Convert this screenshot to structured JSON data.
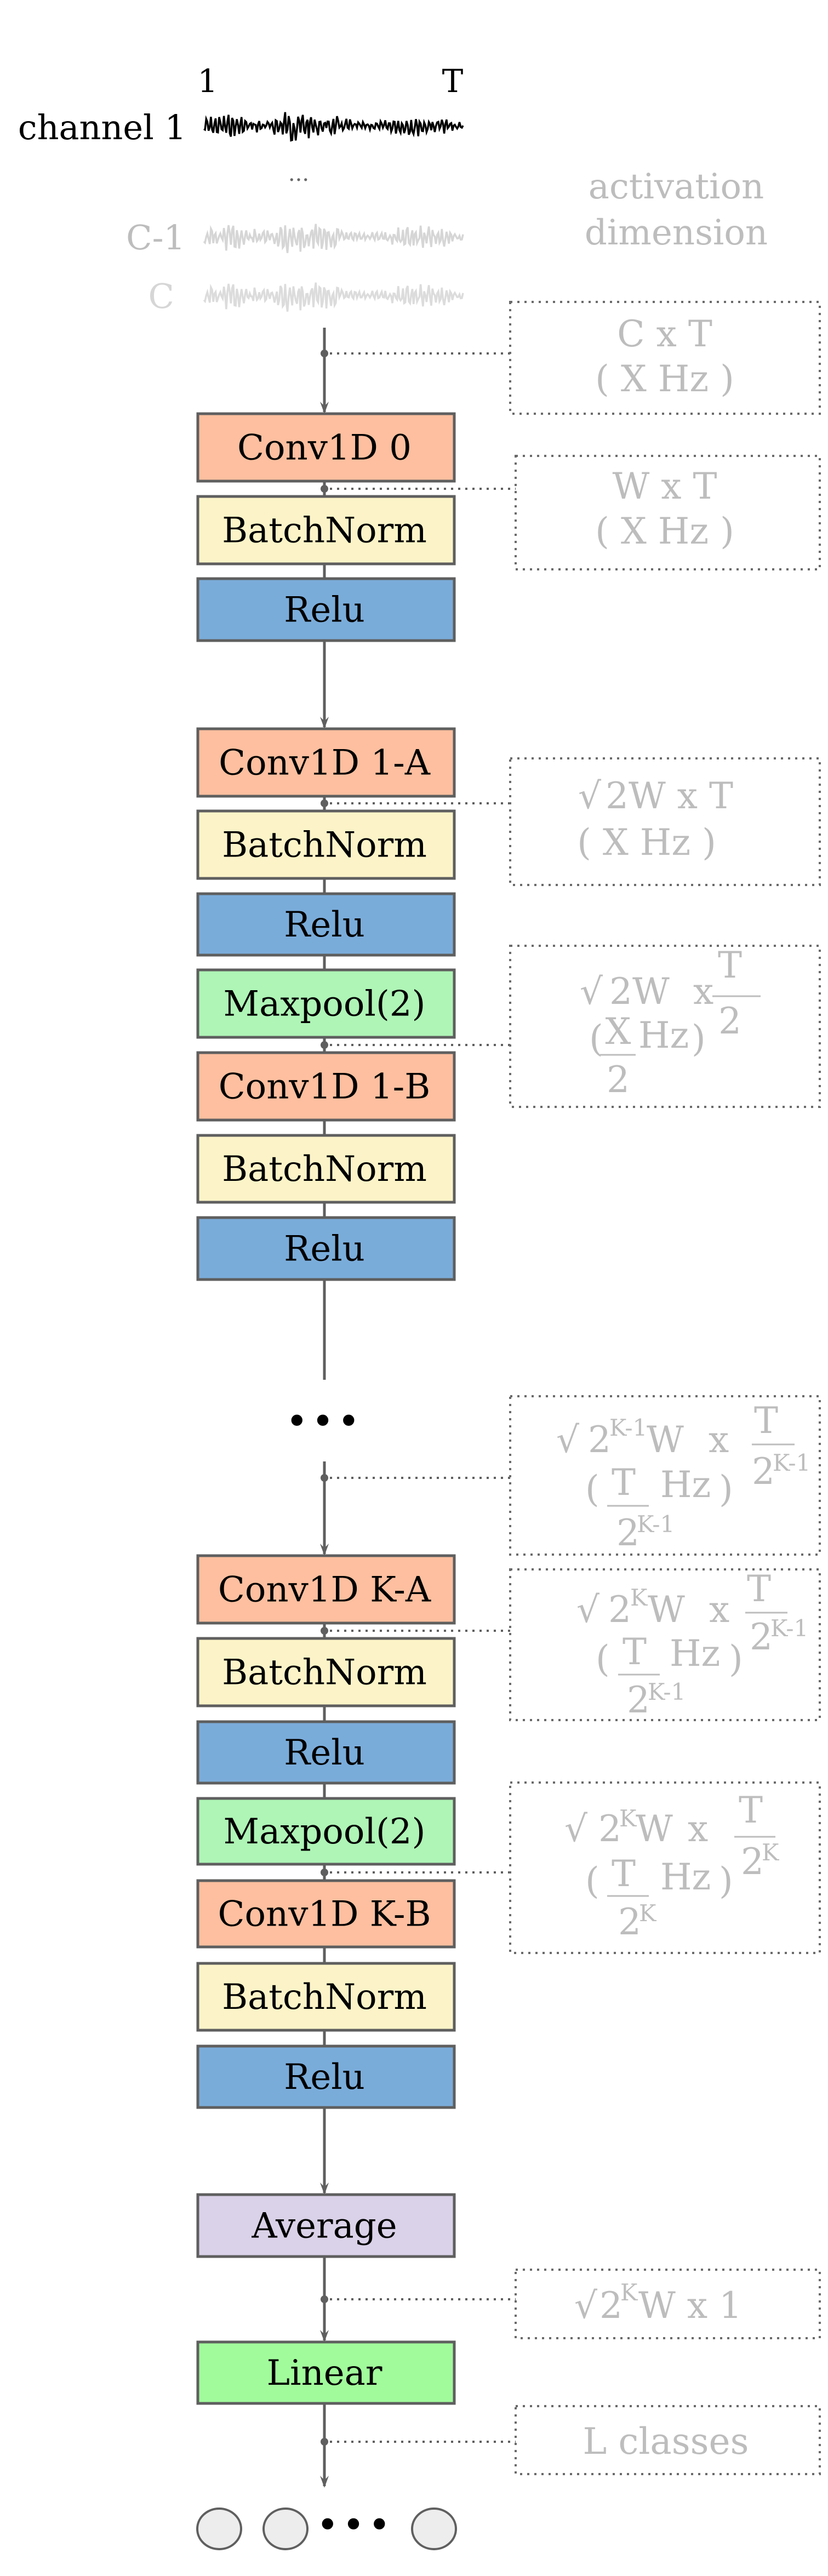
{
  "colors": {
    "conv": "#fdbf9f",
    "batchnorm": "#fcf4c8",
    "relu": "#7aacda",
    "maxpool": "#aef5b6",
    "average": "#dad2e8",
    "linear": "#a1fb9b",
    "output_node": "#ededed",
    "stroke": "#5f5f5f",
    "dim_text": "#bdbdbd"
  },
  "input": {
    "time_start_label": "1",
    "time_end_label": "T",
    "channels": [
      {
        "label": "channel 1",
        "emphasis": "dark"
      },
      {
        "label": "C-1",
        "emphasis": "faded"
      },
      {
        "label": "C",
        "emphasis": "faded"
      }
    ],
    "channel_ellipsis": "..."
  },
  "dimension_header": [
    "activation",
    "dimension"
  ],
  "layers": [
    {
      "label": "Conv1D 0",
      "type": "conv"
    },
    {
      "label": "BatchNorm",
      "type": "batchnorm"
    },
    {
      "label": "Relu",
      "type": "relu"
    },
    {
      "label": "Conv1D 1-A",
      "type": "conv"
    },
    {
      "label": "BatchNorm",
      "type": "batchnorm"
    },
    {
      "label": "Relu",
      "type": "relu"
    },
    {
      "label": "Maxpool(2)",
      "type": "maxpool"
    },
    {
      "label": "Conv1D 1-B",
      "type": "conv"
    },
    {
      "label": "BatchNorm",
      "type": "batchnorm"
    },
    {
      "label": "Relu",
      "type": "relu"
    },
    {
      "label": "Conv1D K-A",
      "type": "conv"
    },
    {
      "label": "BatchNorm",
      "type": "batchnorm"
    },
    {
      "label": "Relu",
      "type": "relu"
    },
    {
      "label": "Maxpool(2)",
      "type": "maxpool"
    },
    {
      "label": "Conv1D K-B",
      "type": "conv"
    },
    {
      "label": "BatchNorm",
      "type": "batchnorm"
    },
    {
      "label": "Relu",
      "type": "relu"
    },
    {
      "label": "Average",
      "type": "average"
    },
    {
      "label": "Linear",
      "type": "linear"
    }
  ],
  "block_ellipsis": "•••",
  "dimensions": {
    "input": {
      "line1": "C x T",
      "line2": "( X Hz )"
    },
    "after_conv0": {
      "line1": "W x T",
      "line2": "( X Hz )"
    },
    "after_conv1a": {
      "sqrt": "√",
      "base": "2W x T",
      "line2": "( X Hz )"
    },
    "after_pool1": {
      "sqrt": "√",
      "base": "2W",
      "times": "x",
      "frac_num": "T",
      "frac_den": "2",
      "hz_num": "X",
      "hz_den": "2",
      "hz_unit": "Hz"
    },
    "before_block_k": {
      "sqrt": "√",
      "base": "2",
      "exp": "K-1",
      "w": "W",
      "times": "x",
      "frac_num": "T",
      "frac_den": "2",
      "frac_den_exp": "K-1",
      "hz_num": "T",
      "hz_den": "2",
      "hz_den_exp": "K-1",
      "hz_unit": "Hz"
    },
    "after_conv_ka": {
      "sqrt": "√",
      "base": "2",
      "exp": "K",
      "w": "W",
      "times": "x",
      "frac_num": "T",
      "frac_den": "2",
      "frac_den_exp": "K-1",
      "hz_num": "T",
      "hz_den": "2",
      "hz_den_exp": "K-1",
      "hz_unit": "Hz"
    },
    "after_pool_k": {
      "sqrt": "√",
      "base": "2",
      "exp": "K",
      "w": "W",
      "times": "x",
      "frac_num": "T",
      "frac_den": "2",
      "frac_den_exp": "K",
      "hz_num": "T",
      "hz_den": "2",
      "hz_den_exp": "K",
      "hz_unit": "Hz"
    },
    "after_average": {
      "sqrt": "√",
      "base": "2",
      "exp": "K",
      "rest": "W x 1"
    },
    "output": {
      "text": "L classes"
    }
  },
  "output_nodes": {
    "count_shown": 3,
    "ellipsis": "•••"
  }
}
